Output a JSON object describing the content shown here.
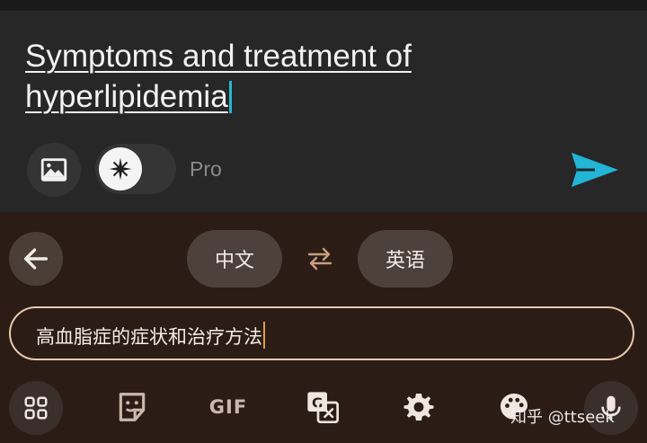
{
  "composer": {
    "query_text": "Symptoms and treatment of hyperlipidemia",
    "pro_label": "Pro"
  },
  "translate": {
    "source_language": "中文",
    "target_language": "英语",
    "input_text": "高血脂症的症状和治疗方法"
  },
  "toolbar": {
    "gif_label": "GIF"
  },
  "watermark": "知乎 @ttseek",
  "colors": {
    "accent_send": "#22b5d6",
    "composer_bg": "#272727",
    "keyboard_bg": "#2b1c16",
    "input_border": "#e8c9ac"
  },
  "icons": [
    "image-icon",
    "sparkle-icon",
    "send-icon",
    "back-arrow-icon",
    "swap-icon",
    "apps-grid-icon",
    "sticker-icon",
    "translate-icon",
    "gear-icon",
    "palette-icon",
    "mic-icon"
  ]
}
